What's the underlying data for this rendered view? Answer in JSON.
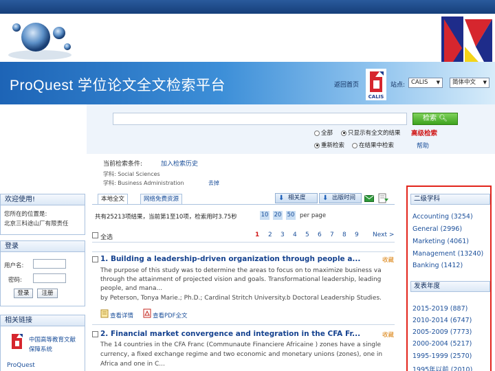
{
  "header": {
    "brand": "ProQuest 学位论文全文检索平台",
    "home_link": "返回首页",
    "calis_label": "CALIS",
    "site_label": "站点:",
    "site_select": "CALIS",
    "lang_select": "简体中文"
  },
  "search": {
    "button_label": "检索",
    "scope_all": "全部",
    "scope_subject": "只显示有全文的结果",
    "mode_new": "重新检索",
    "mode_within": "在结果中检索",
    "advanced": "高级检索",
    "help": "帮助"
  },
  "criteria": {
    "label": "当前检索条件:",
    "add_link": "加入检索历史",
    "line1": "学科: Social Sciences",
    "line2": "学科: Business Administration",
    "remove": "去掉"
  },
  "sidebar": {
    "welcome_title": "欢迎使用!",
    "location_line1": "您所在的位置是:",
    "location_line2": "北京三科途山厂有限责任",
    "login_title": "登录",
    "username_label": "用户名:",
    "password_label": "密码:",
    "login_button": "登录",
    "register_button": "注册",
    "links_title": "相关链接",
    "link1_line1": "中国高等教育文献",
    "link1_line2": "保障系统",
    "link2": "ProQuest"
  },
  "results": {
    "tab_active": "本地全文",
    "tab_other": "网络免费资源",
    "sort_relevance": "相关度",
    "sort_date": "出版时间",
    "stats": "共有25213项结果，当前第1至10项，检索用时3.75秒",
    "per_page_options": [
      "10",
      "20",
      "50"
    ],
    "per_page_label": "per page",
    "select_all": "全选",
    "pages": [
      "1",
      "2",
      "3",
      "4",
      "5",
      "6",
      "7",
      "8",
      "9"
    ],
    "next": "Next >",
    "items": [
      {
        "title": "1. Building a leadership-driven organization through people a...",
        "fav": "收藏",
        "abs1": "The purpose of this study was to determine the areas to focus on to maximize business va",
        "abs2": "through the attainment of projected vision and goals. Transformational leadership, leading",
        "abs3": "people, and mana...",
        "abs4": "by Peterson, Tonya Marie.; Ph.D.; Cardinal Stritch University.b Doctoral Leadership Studies.",
        "link_detail": "查看详情",
        "link_pdf": "查看PDF全文"
      },
      {
        "title": "2. Financial market convergence and integration in the CFA Fr...",
        "fav": "收藏",
        "abs1": "The 14 countries in the CFA Franc (Communaute Financiere Africaine ) zones have a single",
        "abs2": "currency, a fixed exchange regime and two economic and monetary unions (zones), one in",
        "abs3": "Africa and one in C..."
      }
    ]
  },
  "facets": {
    "subject_title": "二级学科",
    "subjects": [
      "Accounting (3254)",
      "General (2996)",
      "Marketing (4061)",
      "Management (13240)",
      "Banking (1412)"
    ],
    "year_title": "发表年度",
    "years": [
      "2015-2019 (887)",
      "2010-2014 (6747)",
      "2005-2009 (7773)",
      "2000-2004 (5217)",
      "1995-1999 (2570)",
      "1995年以前 (2010)"
    ]
  }
}
